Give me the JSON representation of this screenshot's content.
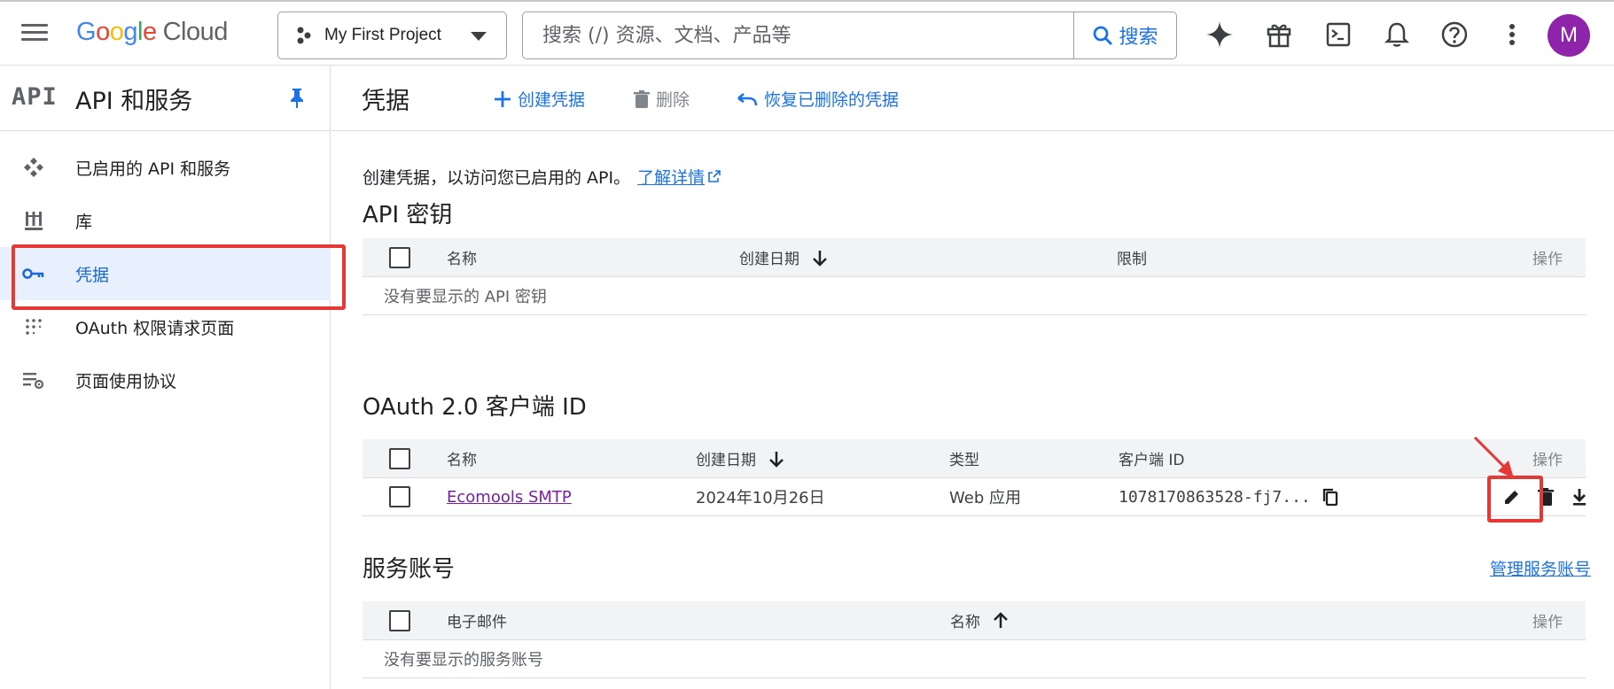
{
  "header": {
    "logo_google": [
      "G",
      "o",
      "o",
      "g",
      "l",
      "e"
    ],
    "logo_cloud": "Cloud",
    "project_name": "My First Project",
    "search_placeholder": "搜索 (/) 资源、文档、产品等",
    "search_button": "搜索",
    "avatar_initial": "M"
  },
  "sidebar": {
    "api_logo": "API",
    "title": "API 和服务",
    "items": [
      {
        "label": "已启用的 API 和服务",
        "icon": "enabled-apis-icon"
      },
      {
        "label": "库",
        "icon": "library-icon"
      },
      {
        "label": "凭据",
        "icon": "key-icon",
        "active": true
      },
      {
        "label": "OAuth 权限请求页面",
        "icon": "oauth-consent-icon"
      },
      {
        "label": "页面使用协议",
        "icon": "page-usage-icon"
      }
    ]
  },
  "main": {
    "title": "凭据",
    "actions": {
      "create": "创建凭据",
      "delete": "删除",
      "restore": "恢复已删除的凭据"
    },
    "intro_text": "创建凭据，以访问您已启用的 API。",
    "learn_more": "了解详情",
    "api_keys": {
      "title": "API 密钥",
      "columns": [
        "名称",
        "创建日期",
        "限制",
        "操作"
      ],
      "empty": "没有要显示的 API 密钥"
    },
    "oauth": {
      "title": "OAuth 2.0 客户端 ID",
      "columns": [
        "名称",
        "创建日期",
        "类型",
        "客户端 ID",
        "操作"
      ],
      "rows": [
        {
          "name": "Ecomools SMTP",
          "date": "2024年10月26日",
          "type": "Web 应用",
          "client_id": "1078170863528-fj7..."
        }
      ]
    },
    "service_accounts": {
      "title": "服务账号",
      "manage_link": "管理服务账号",
      "columns": [
        "电子邮件",
        "名称",
        "操作"
      ],
      "empty": "没有要显示的服务账号"
    }
  },
  "colors": {
    "accent": "#1a73e8",
    "highlight": "#e53935",
    "active_bg": "#e8f0fe",
    "avatar": "#8e24aa"
  }
}
